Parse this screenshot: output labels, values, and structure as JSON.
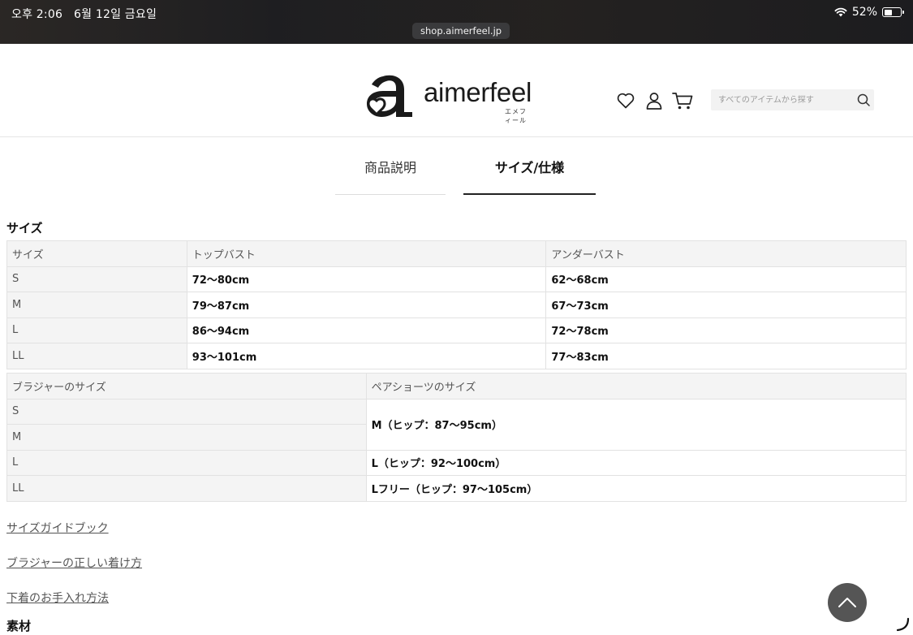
{
  "status_bar": {
    "time": "오후 2:06",
    "date": "6월 12일 금요일",
    "url": "shop.aimerfeel.jp",
    "battery": "52%",
    "battery_level": 0.52
  },
  "header": {
    "logo_text": "aimerfeel",
    "logo_sub": "エメフィール",
    "search_placeholder": "すべてのアイテムから探す"
  },
  "tabs": [
    {
      "label": "商品説明",
      "active": false
    },
    {
      "label": "サイズ/仕様",
      "active": true
    }
  ],
  "size_section": {
    "title": "サイズ",
    "table1": {
      "headers": [
        "サイズ",
        "トップバスト",
        "アンダーバスト"
      ],
      "rows": [
        [
          "S",
          "72〜80cm",
          "62〜68cm"
        ],
        [
          "M",
          "79〜87cm",
          "67〜73cm"
        ],
        [
          "L",
          "86〜94cm",
          "72〜78cm"
        ],
        [
          "LL",
          "93〜101cm",
          "77〜83cm"
        ]
      ]
    },
    "table2": {
      "headers": [
        "ブラジャーのサイズ",
        "ペアショーツのサイズ"
      ],
      "bra_sizes": [
        "S",
        "M",
        "L",
        "LL"
      ],
      "shorts": [
        "M（ヒップ：87〜95cm）",
        "L（ヒップ：92〜100cm）",
        "Lフリー（ヒップ：97〜105cm）"
      ]
    }
  },
  "links": [
    "サイズガイドブック",
    "ブラジャーの正しい着け方",
    "下着のお手入れ方法"
  ],
  "material_title": "素材",
  "colors": {
    "status_bg": "#1c1c1e",
    "table_header_bg": "#f4f4f4",
    "scroll_button": "#555555"
  }
}
